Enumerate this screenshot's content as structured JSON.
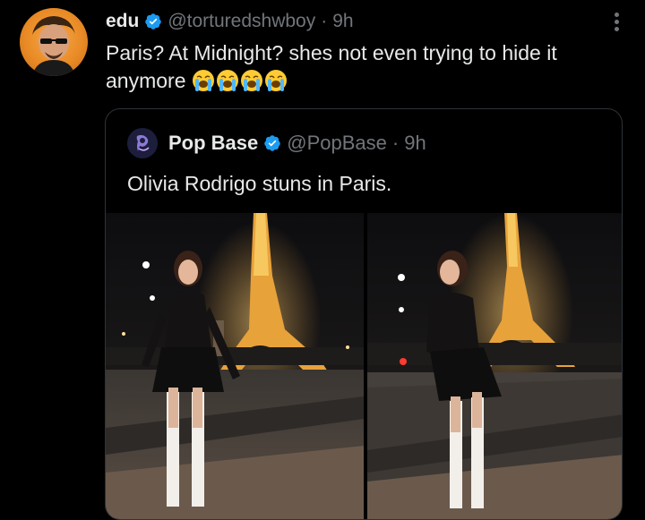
{
  "tweet": {
    "author_name": "edu",
    "author_handle": "@torturedshwboy",
    "separator": "·",
    "time": "9h",
    "text_line1": "Paris? At Midnight? shes not even trying to hide it",
    "text_line2": "anymore",
    "emoji_count": 4,
    "emoji_name": "loudly-crying-face"
  },
  "quoted": {
    "author_name": "Pop Base",
    "author_handle": "@PopBase",
    "separator": "·",
    "time": "9h",
    "text": "Olivia Rodrigo stuns in Paris."
  },
  "colors": {
    "background": "#000000",
    "text": "#e7e9ea",
    "muted": "#71767b",
    "verified_blue": "#1d9bf0",
    "border": "#2f3336"
  }
}
